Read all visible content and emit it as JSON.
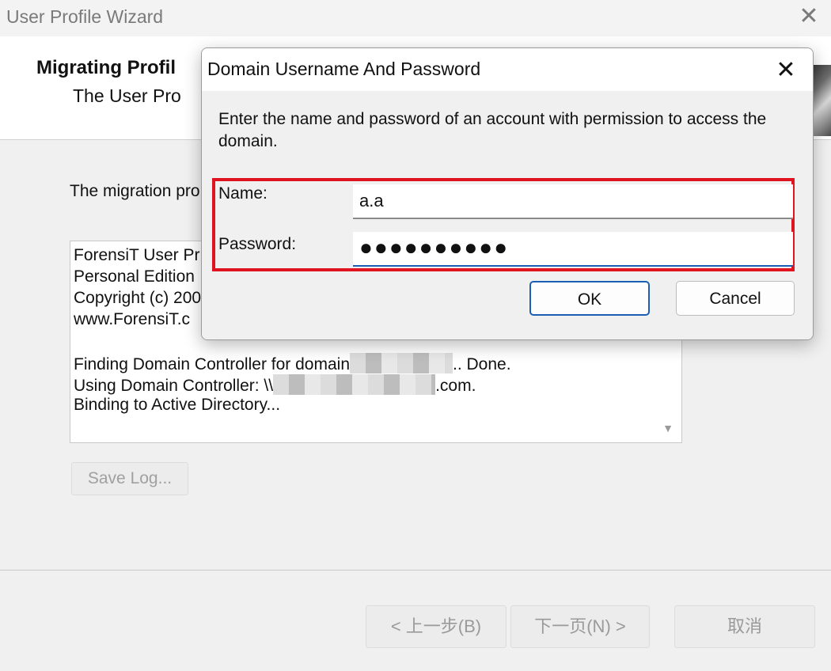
{
  "wizard": {
    "title": "User Profile Wizard",
    "heading": "Migrating Profil",
    "subheading": "The User Pro",
    "intro": "The migration pro",
    "log": {
      "lines": [
        "ForensiT User Pr",
        "Personal Edition",
        "Copyright (c) 200",
        "www.ForensiT.c",
        "",
        "Finding Domain Controller for domain",
        "Using Domain Controller: \\\\",
        "Binding to Active Directory..."
      ],
      "line6_suffix": ".. Done.",
      "line7_suffix": ".com."
    },
    "save_log_label": "Save Log...",
    "back_label": "< 上一步(B)",
    "next_label": "下一页(N) >",
    "cancel_label": "取消"
  },
  "dialog": {
    "title": "Domain Username And Password",
    "prompt": "Enter the name and password of an account with permission to access the domain.",
    "name_label": "Name:",
    "name_value": "a.a",
    "password_label": "Password:",
    "password_value": "●●●●●●●●●●",
    "ok_label": "OK",
    "cancel_label": "Cancel"
  },
  "colors": {
    "highlight": "#e0141e",
    "focus_accent": "#1a5fb4"
  },
  "icons": {
    "close": "close-icon",
    "scroll_down": "chevron-down-icon"
  }
}
